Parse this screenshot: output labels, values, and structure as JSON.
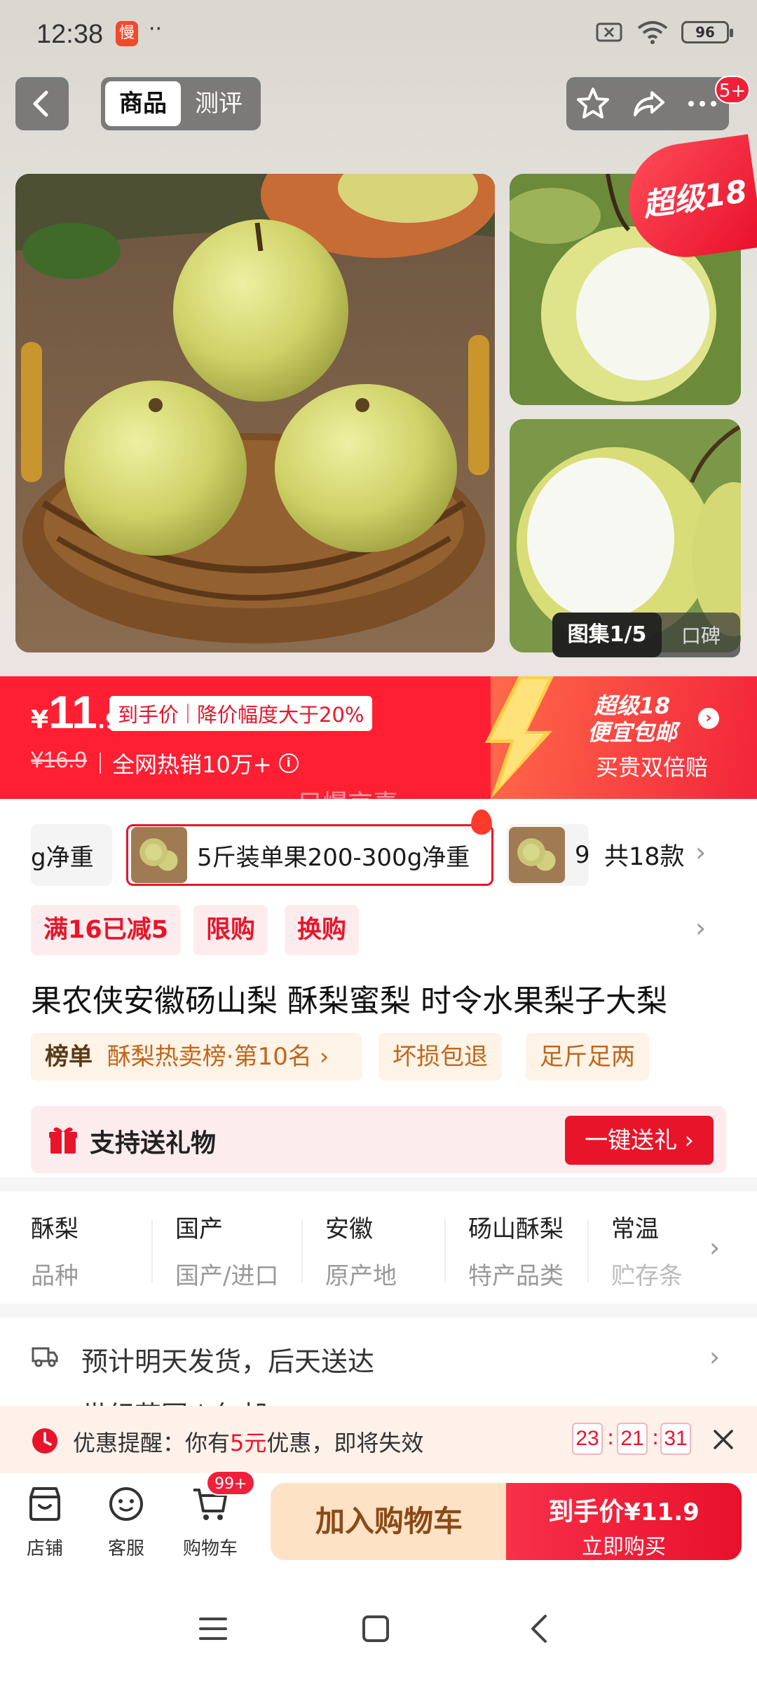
{
  "status_bar": {
    "time": "12:38",
    "app_badge": "慢",
    "dots": "··",
    "battery": "96"
  },
  "header": {
    "tabs": [
      "商品",
      "测评"
    ],
    "notification_count": "5+"
  },
  "gallery": {
    "corner_tag": "超级18",
    "counter": "图集1/5",
    "reviews_tab": "口碑"
  },
  "price": {
    "currency": "¥",
    "integer": "11",
    "decimal": ".9",
    "label": "到手价",
    "drop_note": "降价幅度大于20%",
    "original": "¥16.9",
    "sales": "全网热销10万+",
    "super_title_1": "超级18",
    "super_title_2": "便宜包邮",
    "super_sub": "买贵双倍赔",
    "watermark": "只爆京喜"
  },
  "sku": {
    "prev_label": "g净重",
    "selected_label": "5斤装单果200-300g净重",
    "next_label": "9",
    "total": "共18款"
  },
  "promos": [
    "满16已减5",
    "限购",
    "换购"
  ],
  "product_title": "果农侠安徽砀山梨 酥梨蜜梨 时令水果梨子大梨",
  "rank": {
    "prefix": "榜单",
    "text": "酥梨热卖榜·第10名"
  },
  "guarantees": [
    "坏损包退",
    "足斤足两"
  ],
  "gift": {
    "label": "支持送礼物",
    "button": "一键送礼"
  },
  "attributes": [
    {
      "value": "酥梨",
      "key": "品种"
    },
    {
      "value": "国产",
      "key": "国产/进口"
    },
    {
      "value": "安徽",
      "key": "原产地"
    },
    {
      "value": "砀山酥梨",
      "key": "特产品类"
    },
    {
      "value": "常温",
      "key": "贮存条件"
    }
  ],
  "delivery": {
    "text": "预计明天发货，后天送达",
    "address": "世纪花园 | 包邮"
  },
  "reminder": {
    "prefix": "优惠提醒：你有",
    "amount": "5元",
    "suffix": "优惠，即将失效",
    "hh": "23",
    "mm": "21",
    "ss": "31",
    "colon": ":"
  },
  "bottom_bar": {
    "shop": "店铺",
    "service": "客服",
    "cart": "购物车",
    "cart_badge": "99+",
    "add_to_cart": "加入购物车",
    "buy_price_label": "到手价",
    "buy_price": "¥11.9",
    "buy_now": "立即购买"
  },
  "colors": {
    "brand_red": "#e8152a",
    "price_band": "#ff1f33",
    "cart_button": "#fde2c6"
  }
}
